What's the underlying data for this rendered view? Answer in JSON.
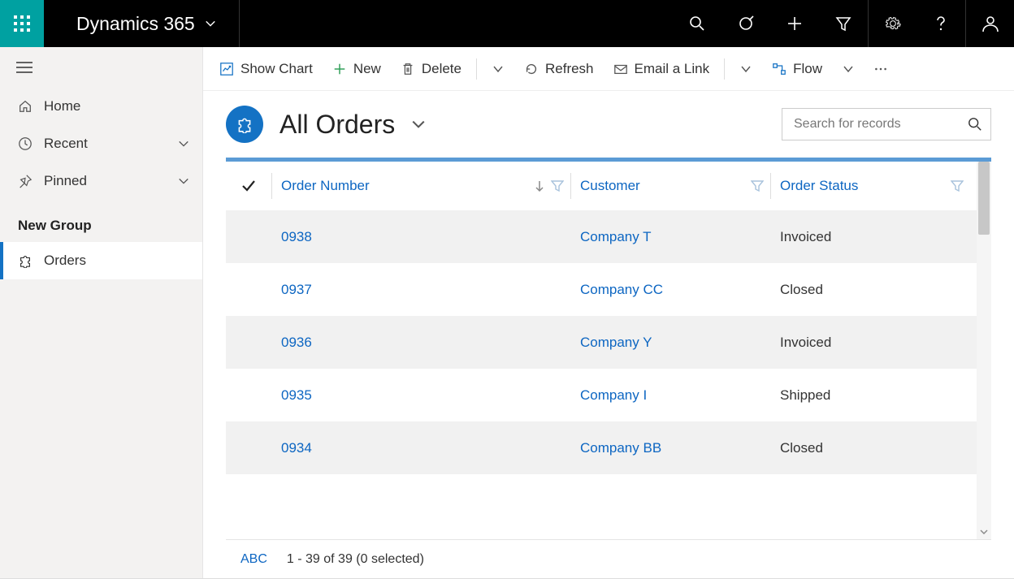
{
  "brand": "Dynamics 365",
  "sidebar": {
    "home": "Home",
    "recent": "Recent",
    "pinned": "Pinned",
    "group": "New Group",
    "active": "Orders"
  },
  "commands": {
    "show_chart": "Show Chart",
    "new": "New",
    "delete": "Delete",
    "refresh": "Refresh",
    "email": "Email a Link",
    "flow": "Flow"
  },
  "view": {
    "title": "All Orders",
    "search_placeholder": "Search for records"
  },
  "grid": {
    "columns": {
      "order_number": "Order Number",
      "customer": "Customer",
      "status": "Order Status"
    },
    "rows": [
      {
        "num": "0938",
        "cust": "Company T",
        "stat": "Invoiced"
      },
      {
        "num": "0937",
        "cust": "Company CC",
        "stat": "Closed"
      },
      {
        "num": "0936",
        "cust": "Company Y",
        "stat": "Invoiced"
      },
      {
        "num": "0935",
        "cust": "Company I",
        "stat": "Shipped"
      },
      {
        "num": "0934",
        "cust": "Company BB",
        "stat": "Closed"
      }
    ],
    "footer": {
      "abc": "ABC",
      "status": "1 - 39 of 39 (0 selected)"
    }
  }
}
